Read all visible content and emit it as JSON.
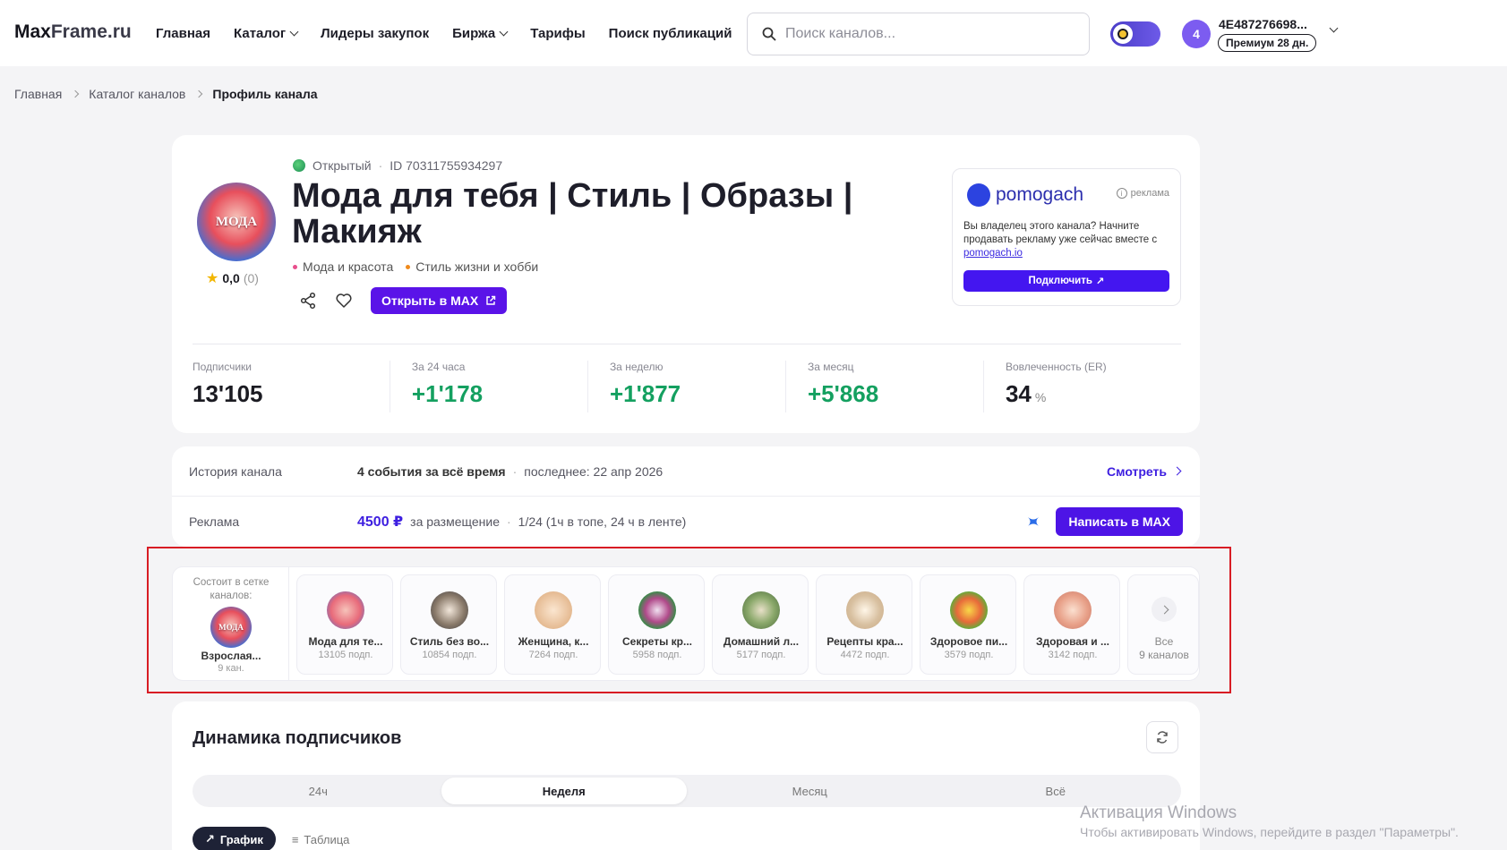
{
  "header": {
    "logo_main": "Max",
    "logo_rest": "Frame.ru",
    "nav": [
      {
        "label": "Главная"
      },
      {
        "label": "Каталог"
      },
      {
        "label": "Лидеры закупок"
      },
      {
        "label": "Биржа"
      },
      {
        "label": "Тарифы"
      },
      {
        "label": "Поиск публикаций"
      }
    ],
    "search_placeholder": "Поиск каналов...",
    "user_avatar_letter": "4",
    "user_name": "4E487276698...",
    "premium_badge": "Премиум 28 дн."
  },
  "breadcrumb": [
    "Главная",
    "Каталог каналов",
    "Профиль канала"
  ],
  "channel": {
    "avatar_text": "МОДА",
    "rating_value": "0,0",
    "rating_count": "(0)",
    "status": "Открытый",
    "id": "ID 70311755934297",
    "title": "Мода для тебя | Стиль | Образы | Макияж",
    "tags": [
      {
        "label": "Мода и красота",
        "color": "#e84f8c"
      },
      {
        "label": "Стиль жизни и хобби",
        "color": "#f08a1c"
      }
    ],
    "open_button": "Открыть в MAX"
  },
  "ad": {
    "brand": "pomogach",
    "label": "реклама",
    "text_before": "Вы владелец этого канала? Начните продавать рекламу уже сейчас вместе с ",
    "link": "pomogach.io",
    "button": "Подключить"
  },
  "stats": [
    {
      "label": "Подписчики",
      "value": "13'105",
      "green": false
    },
    {
      "label": "За 24 часа",
      "value": "+1'178",
      "green": true
    },
    {
      "label": "За неделю",
      "value": "+1'877",
      "green": true
    },
    {
      "label": "За месяц",
      "value": "+5'868",
      "green": true
    },
    {
      "label": "Вовлеченность (ER)",
      "value": "34",
      "unit": "%",
      "green": false
    }
  ],
  "history": {
    "label": "История канала",
    "events": "4 события за всё время",
    "last": "последнее: 22 апр 2026",
    "link": "Смотреть"
  },
  "advert": {
    "label": "Реклама",
    "price": "4500 ₽",
    "per": "за размещение",
    "format": "1/24 (1ч в топе, 24 ч в ленте)",
    "button": "Написать в MAX"
  },
  "network": {
    "label": "Состоит в сетке каналов:",
    "name": "Взрослая...",
    "count": "9 кан.",
    "items": [
      {
        "name": "Мода для те...",
        "subs": "13105 подп.",
        "color": "#e86a7a"
      },
      {
        "name": "Стиль без во...",
        "subs": "10854 подп.",
        "color": "#3b3b40"
      },
      {
        "name": "Женщина, к...",
        "subs": "7264 подп.",
        "color": "#e8c09a"
      },
      {
        "name": "Секреты кр...",
        "subs": "5958 подп.",
        "color": "#3c8a4a"
      },
      {
        "name": "Домашний л...",
        "subs": "5177 подп.",
        "color": "#5a8a3c"
      },
      {
        "name": "Рецепты кра...",
        "subs": "4472 подп.",
        "color": "#c8a884"
      },
      {
        "name": "Здоровое пи...",
        "subs": "3579 подп.",
        "color": "#6aa83a"
      },
      {
        "name": "Здоровая и ...",
        "subs": "3142 подп.",
        "color": "#e8a088"
      }
    ],
    "more_1": "Все",
    "more_2": "9 каналов"
  },
  "dynamics": {
    "title": "Динамика подписчиков",
    "periods": [
      "24ч",
      "Неделя",
      "Месяц",
      "Всё"
    ],
    "active_period": "Неделя",
    "view_chart": "График",
    "view_table": "Таблица"
  },
  "watermark": {
    "line1": "Активация Windows",
    "line2": "Чтобы активировать Windows, перейдите в раздел \"Параметры\"."
  }
}
